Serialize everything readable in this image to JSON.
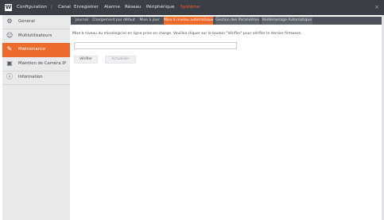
{
  "topbar": {
    "logo": "W",
    "nav": [
      {
        "label": "Configuration"
      },
      {
        "label": "|"
      },
      {
        "label": "Canal"
      },
      {
        "label": "Enregistrer"
      },
      {
        "label": "Alarme"
      },
      {
        "label": "Réseau"
      },
      {
        "label": "Périphérique"
      },
      {
        "label": "Système"
      }
    ],
    "close": "×"
  },
  "sidebar": {
    "items": [
      {
        "label": "Général",
        "icon": "gear-icon"
      },
      {
        "label": "Multiutilisateurs",
        "icon": "user-icon"
      },
      {
        "label": "Maintenance",
        "icon": "wrench-icon"
      },
      {
        "label": "Maintien de Caméra IP",
        "icon": "camera-icon"
      },
      {
        "label": "Information",
        "icon": "info-icon"
      }
    ]
  },
  "tabs": [
    {
      "label": "Journal"
    },
    {
      "label": "Chargement par défaut"
    },
    {
      "label": "Mise à jour"
    },
    {
      "label": "Mise à niveau automatique"
    },
    {
      "label": "Gestion des Paramètres"
    },
    {
      "label": "Redémarrage Automatique"
    }
  ],
  "content": {
    "description": "Mise à niveau du micrologiciel en ligne prise en charge. Veuillez cliquer sur le bouton \"Vérifier\" pour vérifier le dernier firmware.",
    "field_value": "",
    "verify_button": "Vérifier",
    "upgrade_button": "Actualiser"
  },
  "colors": {
    "accent": "#ec6a2b",
    "topbar": "#3a3f47",
    "active_nav": "#ff5a2a"
  }
}
